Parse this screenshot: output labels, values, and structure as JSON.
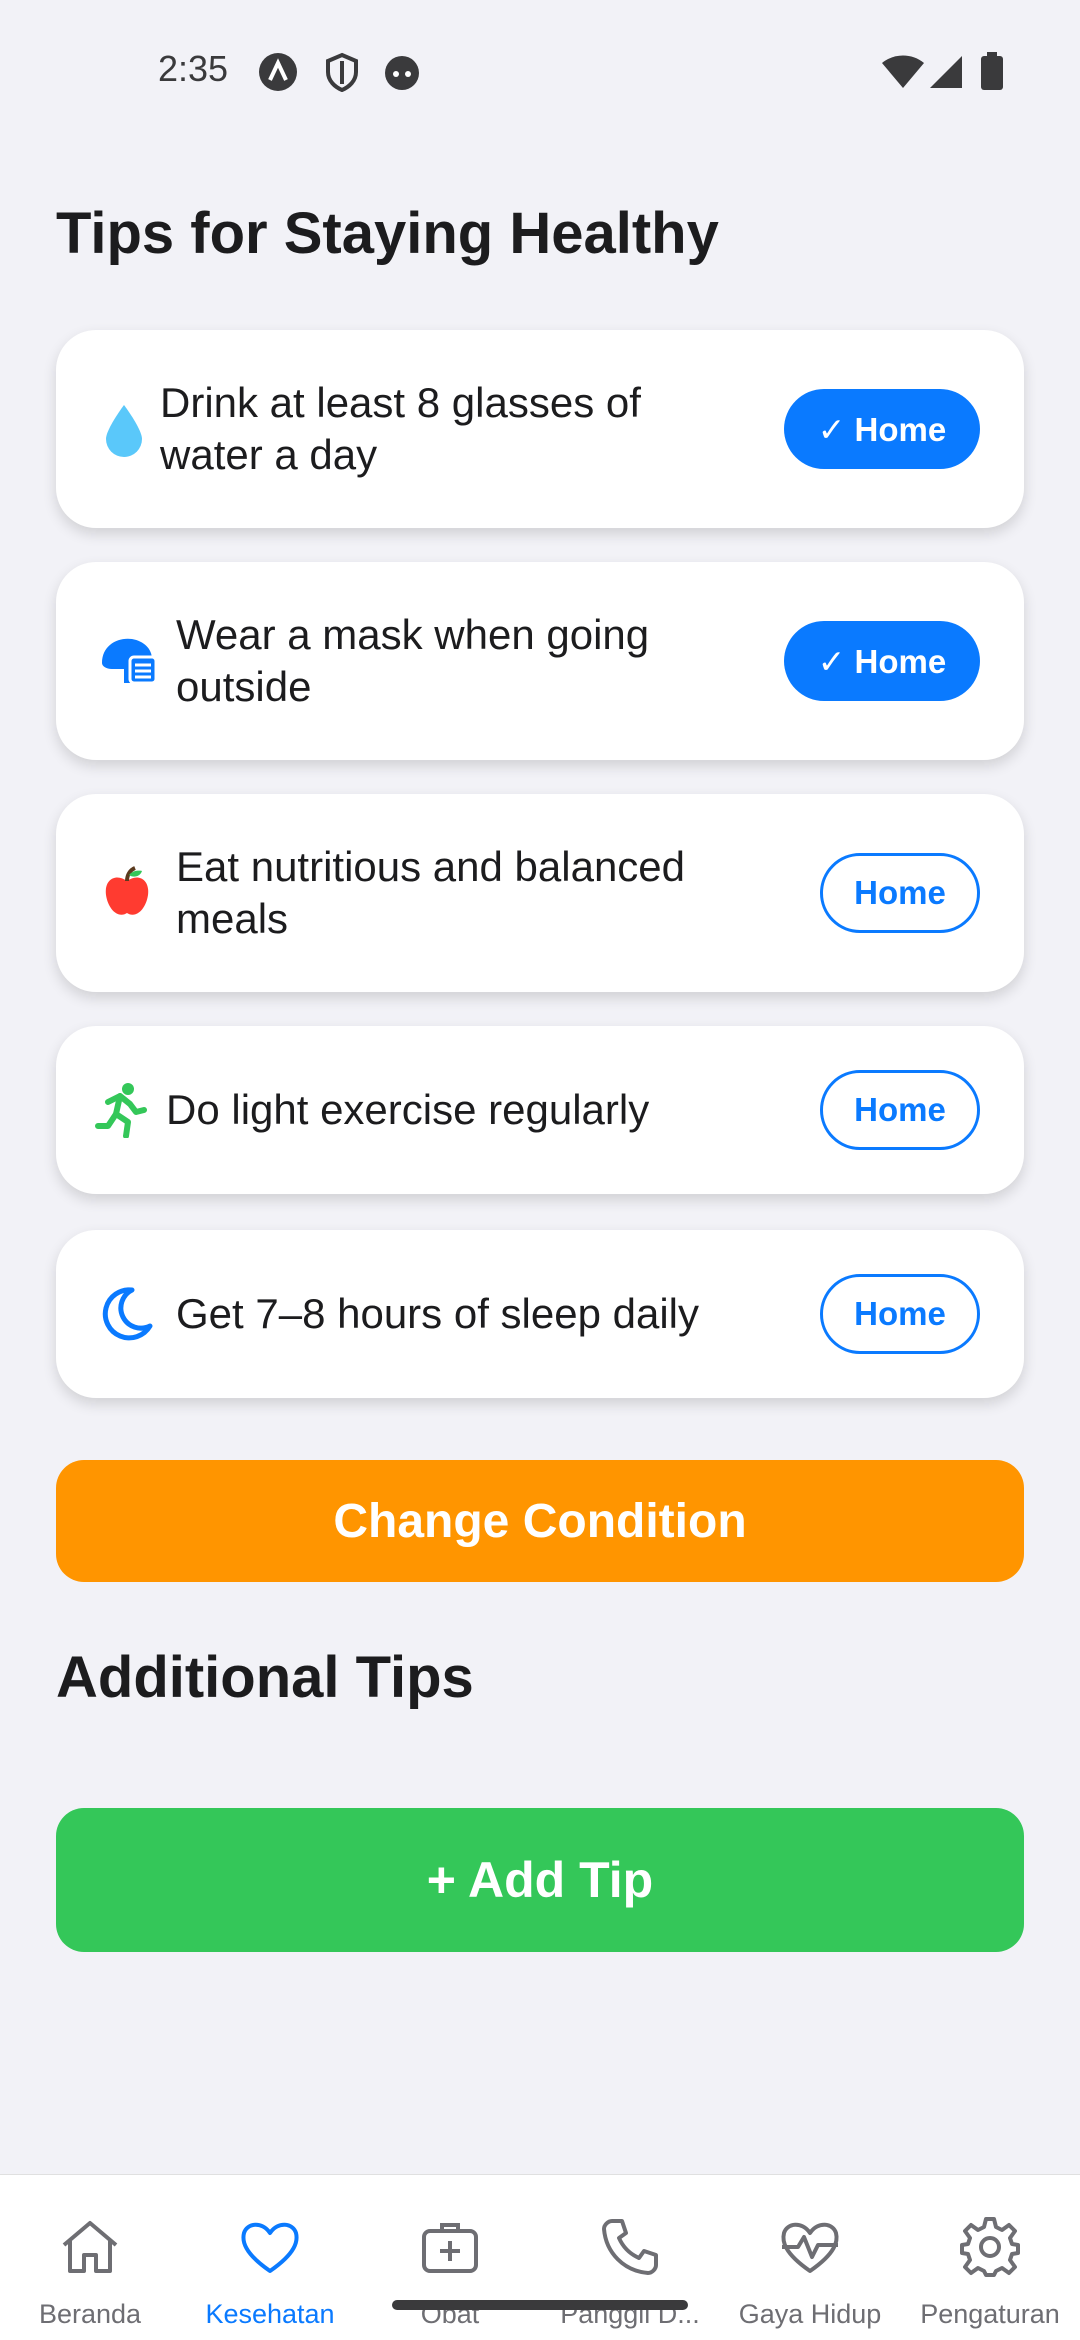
{
  "status_bar": {
    "time": "2:35",
    "icons": [
      "app-a-icon",
      "shield-icon",
      "android-face-icon",
      "wifi-icon",
      "signal-icon",
      "battery-icon"
    ]
  },
  "main": {
    "title": "Tips for Staying Healthy",
    "tips": [
      {
        "icon": "water-drop-icon",
        "text": "Drink at least 8 glasses of water a day",
        "button": "✓ Home",
        "selected": true
      },
      {
        "icon": "mask-icon",
        "text": "Wear a mask when going outside",
        "button": "✓ Home",
        "selected": true
      },
      {
        "icon": "apple-icon",
        "text": "Eat nutritious and balanced meals",
        "button": "Home",
        "selected": false
      },
      {
        "icon": "running-icon",
        "text": "Do light exercise regularly",
        "button": "Home",
        "selected": false
      },
      {
        "icon": "moon-icon",
        "text": "Get 7–8 hours of sleep daily",
        "button": "Home",
        "selected": false
      }
    ],
    "change_condition_label": "Change Condition",
    "additional_title": "Additional Tips",
    "add_tip_label": "+ Add Tip"
  },
  "bottom_nav": {
    "items": [
      {
        "label": "Beranda",
        "icon": "home-icon",
        "active": false
      },
      {
        "label": "Kesehatan",
        "icon": "heart-icon",
        "active": true
      },
      {
        "label": "Obat",
        "icon": "medical-kit-icon",
        "active": false
      },
      {
        "label": "Panggil D...",
        "icon": "phone-icon",
        "active": false
      },
      {
        "label": "Gaya Hidup",
        "icon": "heart-pulse-icon",
        "active": false
      },
      {
        "label": "Pengaturan",
        "icon": "gear-icon",
        "active": false
      }
    ]
  },
  "colors": {
    "accent": "#0a7aff",
    "orange": "#ff9500",
    "green": "#34c759",
    "background": "#f2f2f7"
  }
}
